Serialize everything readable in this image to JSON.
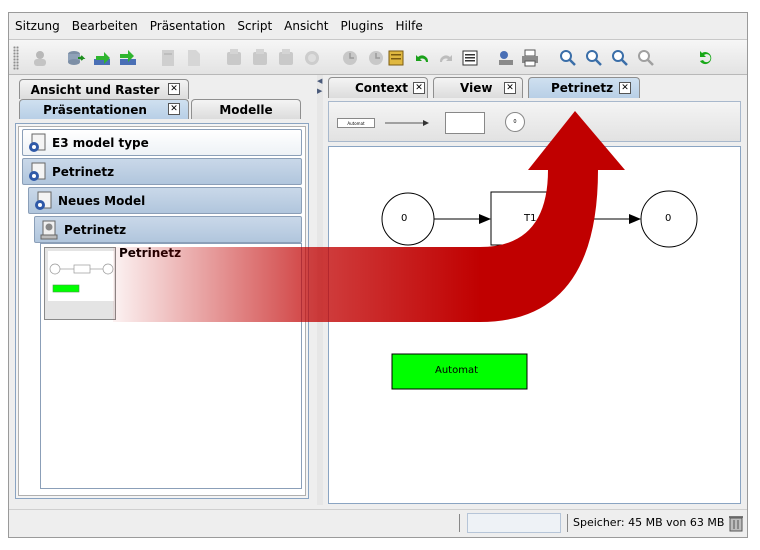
{
  "menu": {
    "items": [
      {
        "label": "Sitzung",
        "name": "menu-sitzung"
      },
      {
        "label": "Bearbeiten",
        "name": "menu-bearbeiten"
      },
      {
        "label": "Präsentation",
        "name": "menu-praesentation"
      },
      {
        "label": "Script",
        "name": "menu-script"
      },
      {
        "label": "Ansicht",
        "name": "menu-ansicht"
      },
      {
        "label": "Plugins",
        "name": "menu-plugins"
      },
      {
        "label": "Hilfe",
        "name": "menu-hilfe"
      }
    ]
  },
  "toolbar": {
    "icons": [
      "agent-icon",
      "database-export-icon",
      "import-icon",
      "export-icon",
      "document-icon",
      "blank-document-icon",
      "component-icon",
      "component-icon",
      "component-icon",
      "globe-icon",
      "clock-icon",
      "certificate-icon",
      "undo-icon",
      "redo-icon",
      "list-icon",
      "network-icon",
      "printer-icon",
      "zoom-in-icon",
      "zoom-icon",
      "zoom-out-icon",
      "zoom-fit-icon",
      "refresh-icon"
    ]
  },
  "left_tabs": {
    "top": {
      "label": "Ansicht und Raster",
      "close": "✕"
    },
    "praesentationen": {
      "label": "Präsentationen",
      "close": "✕"
    },
    "modelle": {
      "label": "Modelle"
    }
  },
  "tree": {
    "e3": "E3 model type",
    "petrinetz_root": "Petrinetz",
    "neues_model": "Neues Model",
    "petrinetz_child": "Petrinetz",
    "thumbnail_label": "Petrinetz"
  },
  "right_tabs": [
    {
      "label": "Context",
      "close": "✕"
    },
    {
      "label": "View",
      "close": "✕"
    },
    {
      "label": "Petrinetz",
      "close": "✕"
    }
  ],
  "palette": {
    "items": [
      "Automat",
      "arrow",
      "rectangle",
      "0"
    ]
  },
  "canvas": {
    "place_left": "0",
    "transition": "T1",
    "place_right": "0",
    "automat": "Automat"
  },
  "status": {
    "memory": "Speicher: 45 MB  von 63 MB"
  },
  "colors": {
    "tab_active": "#b8cfe6",
    "tree_blue": "#b1c6dd",
    "automat_green": "#00ff00",
    "overlay_arrow": "#c00000",
    "accent_icon_green": "#22aa22"
  }
}
